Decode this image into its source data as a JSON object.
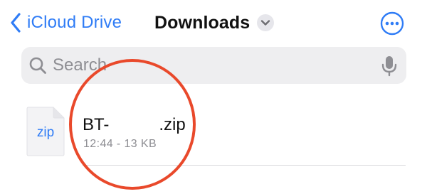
{
  "nav": {
    "back_label": "iCloud Drive",
    "title": "Downloads"
  },
  "search": {
    "placeholder": "Search"
  },
  "files": [
    {
      "thumb_label": "zip",
      "name_prefix": "BT-",
      "name_suffix": ".zip",
      "meta": "12:44 - 13 KB"
    }
  ],
  "colors": {
    "accent": "#2f7cf6",
    "annotation": "#e9492b",
    "search_bg": "#eeeef0",
    "secondary_text": "#8e8e93"
  },
  "icons": {
    "back": "chevron-left-icon",
    "title_menu": "chevron-down-icon",
    "more": "ellipsis-circle-icon",
    "search": "magnifier-icon",
    "mic": "microphone-icon",
    "file": "zip-document-icon"
  }
}
